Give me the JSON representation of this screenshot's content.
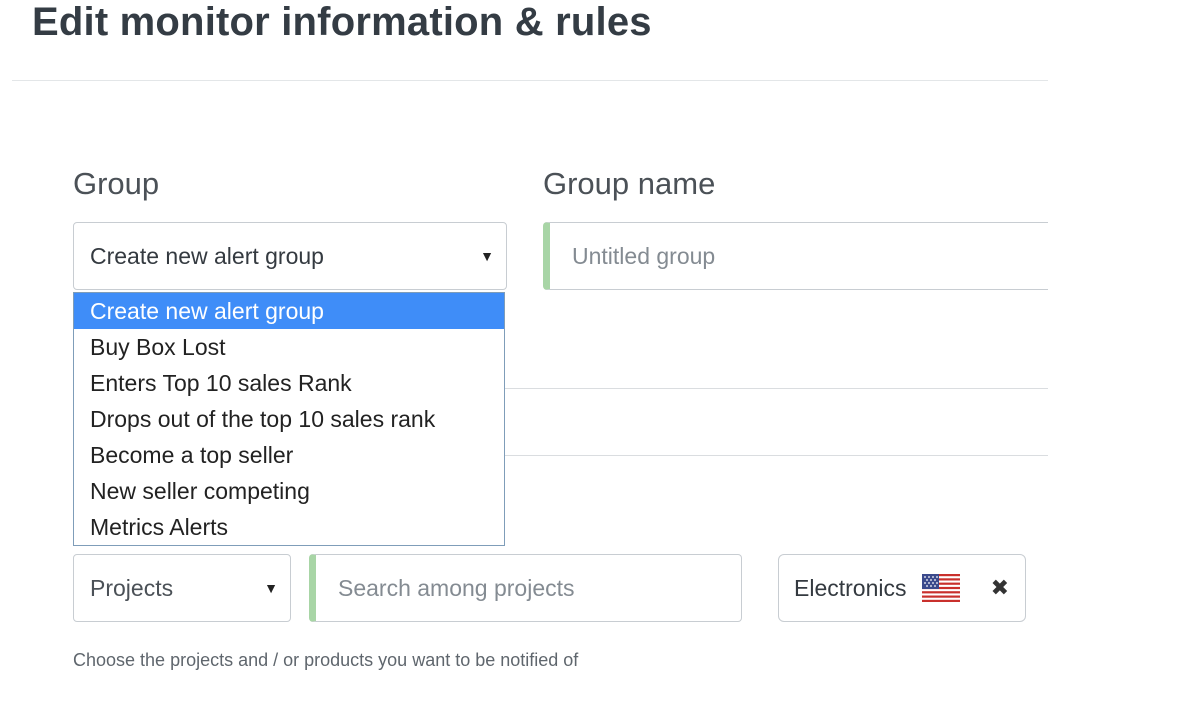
{
  "header": {
    "title": "Edit monitor information & rules"
  },
  "form": {
    "group_label": "Group",
    "group_name_label": "Group name",
    "group_select": {
      "selected": "Create new alert group",
      "options": [
        "Create new alert group",
        "Buy Box Lost",
        "Enters Top 10 sales Rank",
        "Drops out of the top 10 sales rank",
        "Become a top seller",
        "New seller competing",
        "Metrics Alerts"
      ]
    },
    "group_name_placeholder": "Untitled group",
    "scope_select": {
      "selected": "Projects"
    },
    "search_placeholder": "Search among projects",
    "selected_tag": {
      "label": "Electronics",
      "flag_icon": "us-flag-icon"
    },
    "help_text": "Choose the projects and / or products you want to be notified of"
  },
  "colors": {
    "dropdown_highlight": "#3f8df8",
    "input_accent": "#a8d5a6"
  }
}
